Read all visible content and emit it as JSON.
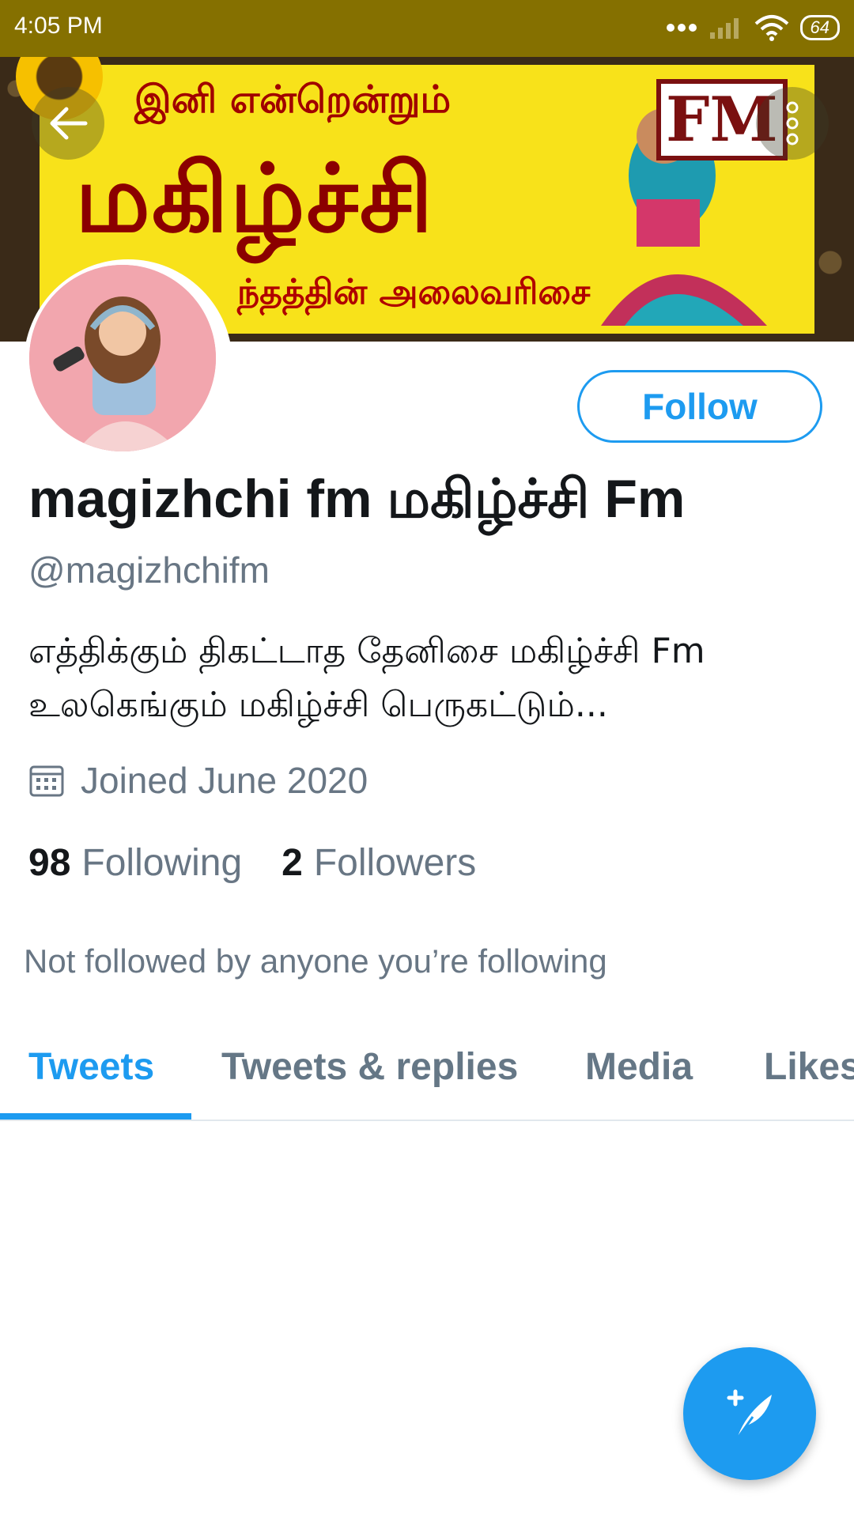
{
  "status_bar": {
    "time": "4:05 PM",
    "battery": "64",
    "icons": [
      "dots-icon",
      "signal-icon",
      "wifi-icon",
      "battery-icon"
    ]
  },
  "banner": {
    "line1": "இனி என்றென்றும்",
    "line2": "மகிழ்ச்சி",
    "line3": "ந்தத்தின் அலைவரிசை",
    "fm_text": "FM"
  },
  "profile": {
    "display_name": "magizhchi fm மகிழ்ச்சி Fm",
    "handle": "@magizhchifm",
    "bio": "எத்திக்கும் திகட்டாத தேனிசை   மகிழ்ச்சி Fm உலகெங்கும் மகிழ்ச்சி பெருகட்டும்...",
    "joined": "Joined June 2020",
    "following_count": "98",
    "following_label": "Following",
    "followers_count": "2",
    "followers_label": "Followers",
    "not_followed_text": "Not followed by anyone you’re following"
  },
  "actions": {
    "follow_label": "Follow"
  },
  "tabs": [
    {
      "label": "Tweets",
      "active": true
    },
    {
      "label": "Tweets & replies",
      "active": false
    },
    {
      "label": "Media",
      "active": false
    },
    {
      "label": "Likes",
      "active": false
    }
  ],
  "colors": {
    "accent": "#1d9bf0",
    "status_bar": "#857000",
    "secondary_text": "#687684"
  }
}
